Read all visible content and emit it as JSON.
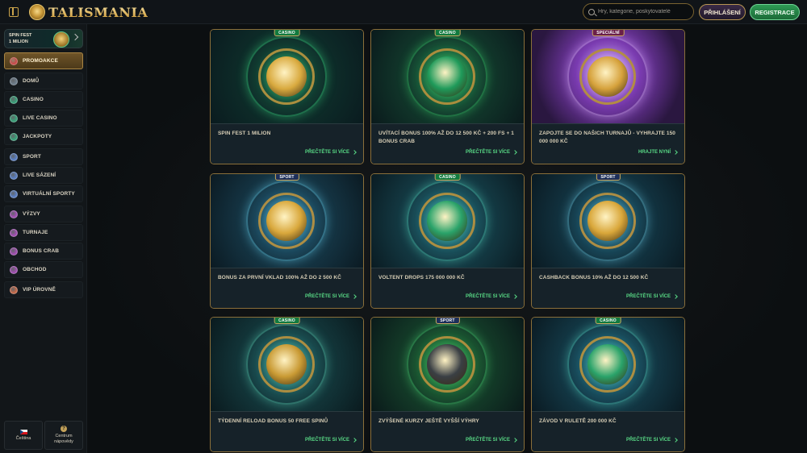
{
  "header": {
    "logo_text": "TALISMANIA",
    "search_placeholder": "Hry, kategorie, poskytovatelé",
    "login_label": "PŘIHLÁŠENÍ",
    "register_label": "REGISTRACE"
  },
  "sidebar": {
    "promo_card": {
      "line1": "SPIN FEST",
      "line2": "1 MILION"
    },
    "items": [
      {
        "label": "PROMOAKCE",
        "icon": "gift-icon",
        "active": true
      },
      {
        "label": "DOMŮ",
        "icon": "home-icon"
      },
      {
        "label": "CASINO",
        "icon": "casino-chip-icon"
      },
      {
        "label": "LIVE CASINO",
        "icon": "live-casino-icon"
      },
      {
        "label": "JACKPOTY",
        "icon": "jackpot-icon"
      },
      {
        "label": "SPORT",
        "icon": "soccer-ball-icon"
      },
      {
        "label": "LIVE SÁZENÍ",
        "icon": "live-betting-icon"
      },
      {
        "label": "VIRTUÁLNÍ SPORTY",
        "icon": "virtual-sports-icon"
      },
      {
        "label": "VÝZVY",
        "icon": "challenges-icon"
      },
      {
        "label": "TURNAJE",
        "icon": "tournament-icon"
      },
      {
        "label": "BONUS CRAB",
        "icon": "crab-icon"
      },
      {
        "label": "OBCHOD",
        "icon": "shop-icon"
      },
      {
        "label": "VIP ÚROVNĚ",
        "icon": "vip-gem-icon"
      }
    ],
    "footer": {
      "language_label": "Čeština",
      "help_label": "Centrum nápovědy"
    }
  },
  "cards": [
    {
      "badge": "CASINO",
      "badge_type": "casino",
      "title": "SPIN FEST 1 MILION",
      "link": "PŘEČTĚTE SI VÍCE",
      "art_name": "golden-coin-art"
    },
    {
      "badge": "CASINO",
      "badge_type": "casino",
      "title": "UVÍTACÍ BONUS 100% AŽ DO 12 500 KČ + 200 FS + 1 BONUS CRAB",
      "link": "PŘEČTĚTE SI VÍCE",
      "art_name": "scarab-art"
    },
    {
      "badge": "SPECIÁLNÍ",
      "badge_type": "special",
      "title": "ZAPOJTE SE DO NAŠICH TURNAJŮ - VYHRAJTE 150 000 000 KČ",
      "link": "HRAJTE NYNÍ",
      "art_name": "trophy-art"
    },
    {
      "badge": "SPORT",
      "badge_type": "sport",
      "title": "BONUS ZA PRVNÍ VKLAD 100% AŽ DO 2 500 KČ",
      "link": "PŘEČTĚTE SI VÍCE",
      "art_name": "winged-ball-art"
    },
    {
      "badge": "CASINO",
      "badge_type": "casino",
      "title": "VOLTENT DROPS 175 000 000 KČ",
      "link": "PŘEČTĚTE SI VÍCE",
      "art_name": "eye-of-horus-art"
    },
    {
      "badge": "SPORT",
      "badge_type": "sport",
      "title": "CASHBACK BONUS 10% AŽ DO 12 500 KČ",
      "link": "PŘEČTĚTE SI VÍCE",
      "art_name": "pharaoh-mask-art"
    },
    {
      "badge": "CASINO",
      "badge_type": "casino",
      "title": "TÝDENNÍ RELOAD BONUS 50 FREE SPINŮ",
      "link": "PŘEČTĚTE SI VÍCE",
      "art_name": "horus-falcon-art"
    },
    {
      "badge": "SPORT",
      "badge_type": "sport",
      "title": "ZVÝŠENÉ KURZY JEŠTĚ VYŠŠÍ VÝHRY",
      "link": "PŘEČTĚTE SI VÍCE",
      "art_name": "anubis-art"
    },
    {
      "badge": "CASINO",
      "badge_type": "casino",
      "title": "ZÁVOD V RULETĚ 200 000 KČ",
      "link": "PŘEČTĚTE SI VÍCE",
      "art_name": "horus-amulet-art"
    }
  ],
  "colors": {
    "accent_gold": "#c9a34a",
    "link_green": "#58d985",
    "casino_badge": "#127a3f",
    "sport_badge": "#1d2f5a",
    "special_badge": "#6a1f4a"
  }
}
